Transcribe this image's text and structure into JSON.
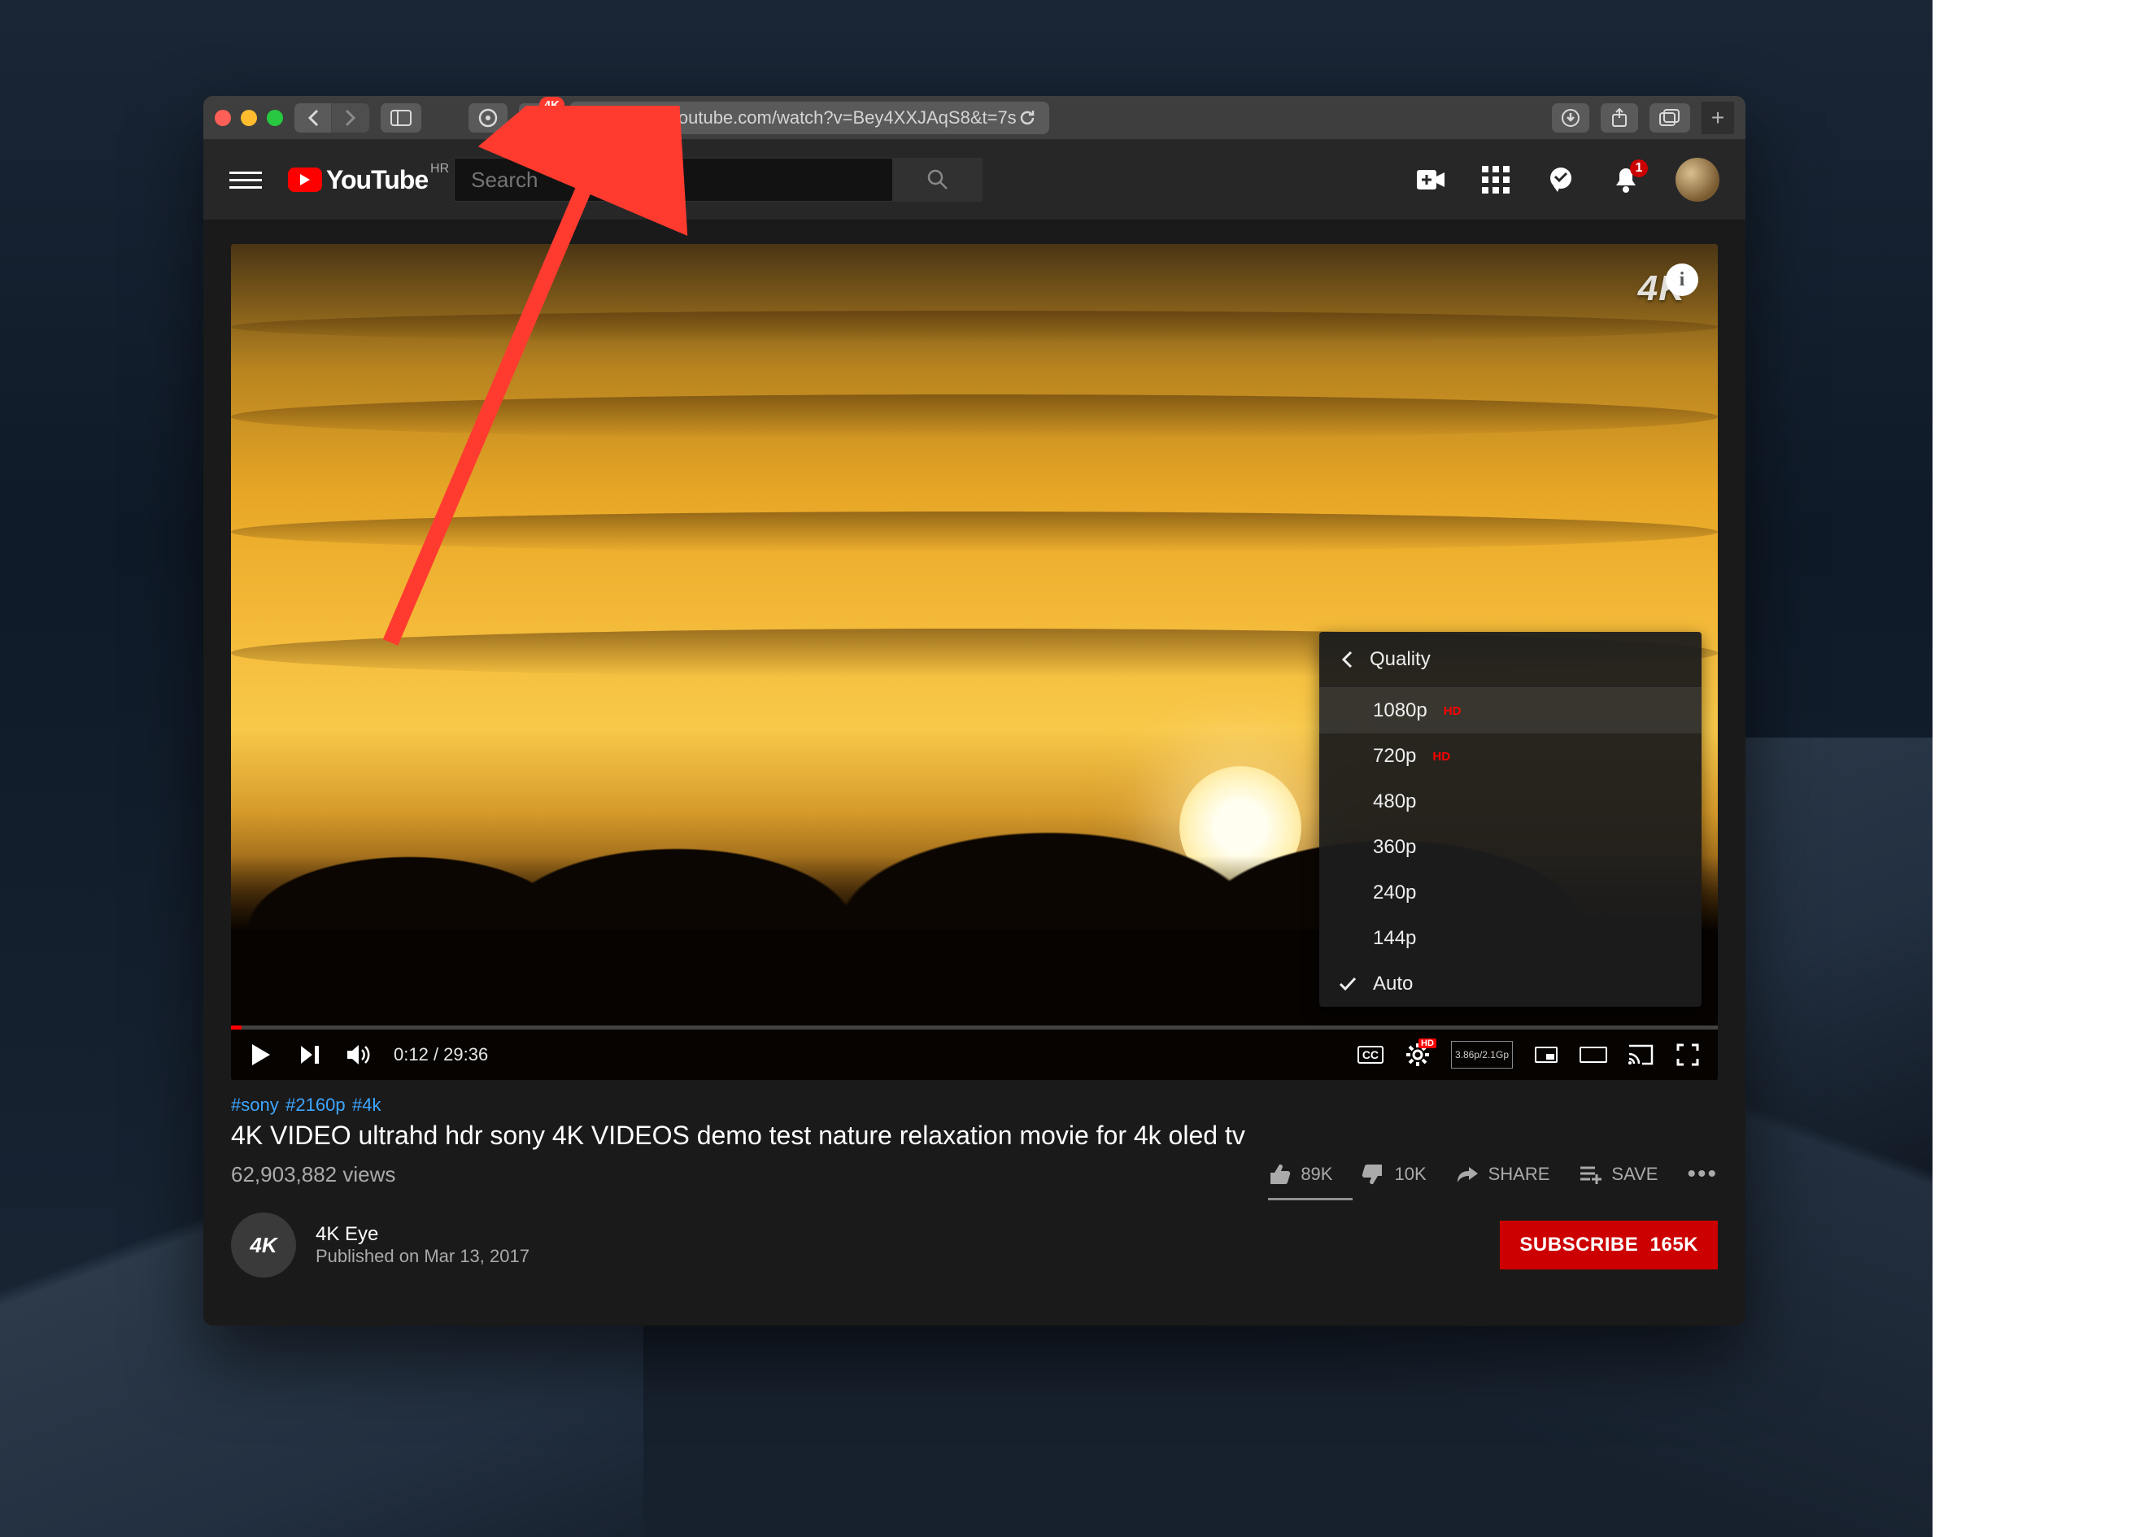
{
  "browser": {
    "url": "www.youtube.com/watch?v=Bey4XXJAqS8&t=7s",
    "extension_badge": "4K"
  },
  "youtube": {
    "logo_text": "YouTube",
    "country_code": "HR",
    "search_placeholder": "Search",
    "notification_count": "1"
  },
  "player": {
    "watermark": "4K",
    "time_current": "0:12",
    "time_total": "29:36",
    "quality_menu": {
      "title": "Quality",
      "options": [
        {
          "label": "1080p",
          "hd": true,
          "selected": false,
          "hover": true
        },
        {
          "label": "720p",
          "hd": true,
          "selected": false
        },
        {
          "label": "480p",
          "hd": false,
          "selected": false
        },
        {
          "label": "360p",
          "hd": false,
          "selected": false
        },
        {
          "label": "240p",
          "hd": false,
          "selected": false
        },
        {
          "label": "144p",
          "hd": false,
          "selected": false
        },
        {
          "label": "Auto",
          "hd": false,
          "selected": true
        }
      ]
    },
    "settings_badge": "HD",
    "stats_overlay": "3.86p/2.1Gp"
  },
  "video": {
    "hashtags": [
      "#sony",
      "#2160p",
      "#4k"
    ],
    "title": "4K VIDEO ultrahd hdr sony 4K VIDEOS demo test nature relaxation movie for 4k oled tv",
    "views": "62,903,882 views",
    "likes": "89K",
    "dislikes": "10K",
    "share_label": "SHARE",
    "save_label": "SAVE"
  },
  "channel": {
    "avatar_text": "4K",
    "name": "4K Eye",
    "published": "Published on Mar 13, 2017",
    "subscribe_label": "SUBSCRIBE",
    "subscriber_count": "165K"
  }
}
